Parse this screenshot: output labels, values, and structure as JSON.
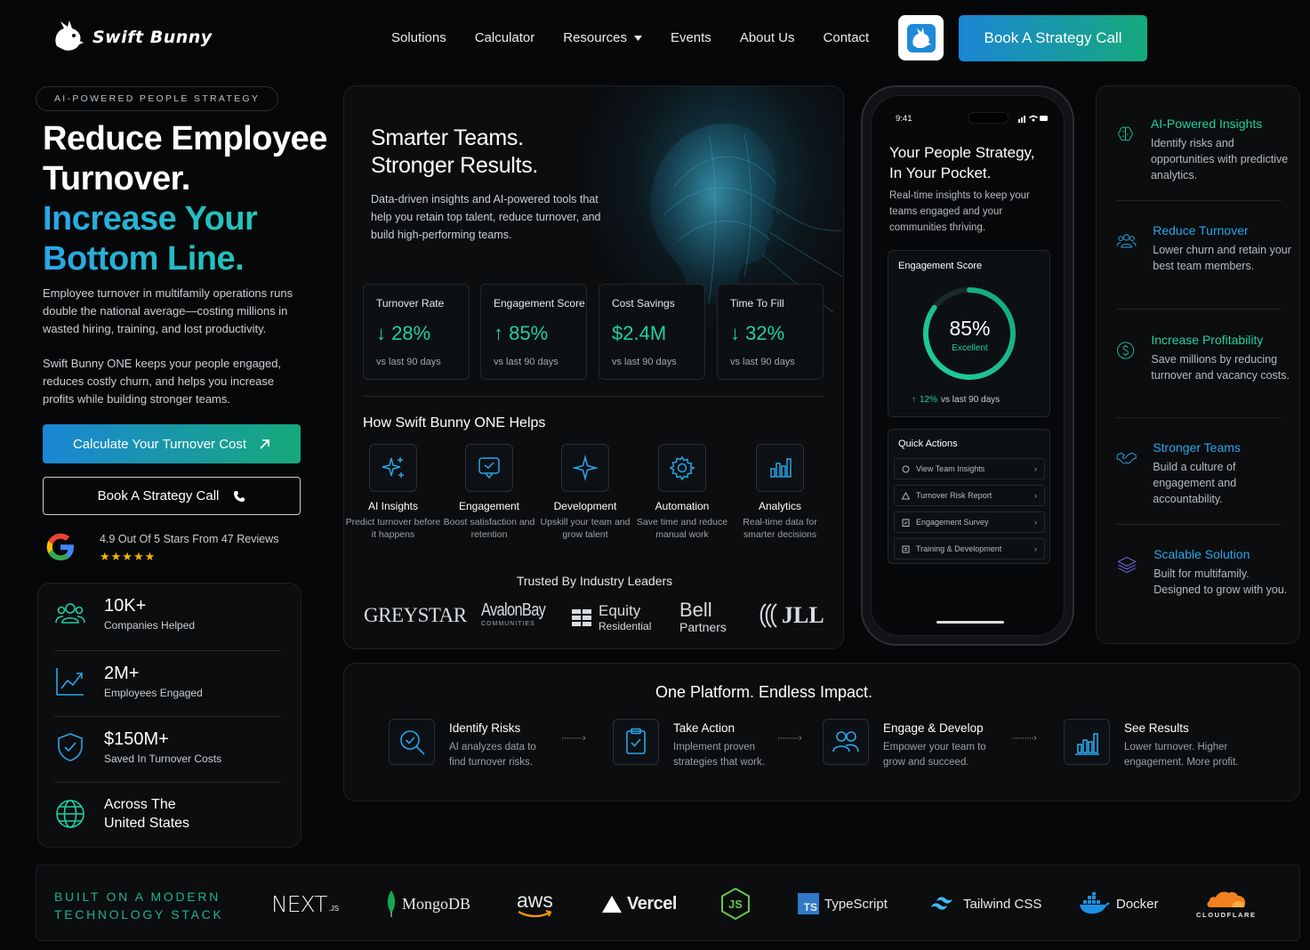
{
  "header": {
    "brand": "Swift Bunny",
    "nav": [
      "Solutions",
      "Calculator",
      "Resources",
      "Events",
      "About Us",
      "Contact"
    ],
    "cta": "Book A Strategy Call"
  },
  "hero": {
    "eyebrow": "AI-POWERED PEOPLE STRATEGY",
    "title_line1": "Reduce Employee",
    "title_line2": "Turnover.",
    "title_line3": "Increase Your",
    "title_line4": "Bottom Line.",
    "para1": "Employee turnover in multifamily operations runs double the national average—costing millions in wasted hiring, training, and lost productivity.",
    "para2": "Swift Bunny ONE keeps your people engaged, reduces costly churn, and helps you increase profits while building stronger teams.",
    "btn_calc": "Calculate Your Turnover Cost",
    "btn_book": "Book A Strategy Call",
    "rating": "4.9 Out Of 5 Stars From 47 Reviews",
    "stars": "★★★★★"
  },
  "stats": [
    {
      "value": "10K+",
      "label": "Companies Helped"
    },
    {
      "value": "2M+",
      "label": "Employees Engaged"
    },
    {
      "value": "$150M+",
      "label": "Saved In Turnover Costs"
    },
    {
      "value": "Across The United States",
      "label": ""
    }
  ],
  "center": {
    "title_line1": "Smarter Teams.",
    "title_line2": "Stronger Results.",
    "subtitle": "Data-driven insights and AI-powered tools that help you retain top talent, reduce turnover, and build high-performing teams.",
    "metrics": [
      {
        "title": "Turnover Rate",
        "value": "↓ 28%",
        "sub": "vs last 90 days"
      },
      {
        "title": "Engagement Score",
        "value": "↑ 85%",
        "sub": "vs last 90 days"
      },
      {
        "title": "Cost Savings",
        "value": "$2.4M",
        "sub": "vs last 90 days"
      },
      {
        "title": "Time To Fill",
        "value": "↓ 32%",
        "sub": "vs last 90 days"
      }
    ],
    "how_title": "How Swift Bunny ONE Helps",
    "features": [
      {
        "title": "AI Insights",
        "sub": "Predict turnover before it happens"
      },
      {
        "title": "Engagement",
        "sub": "Boost satisfaction and retention"
      },
      {
        "title": "Development",
        "sub": "Upskill your team and grow talent"
      },
      {
        "title": "Automation",
        "sub": "Save time and reduce manual work"
      },
      {
        "title": "Analytics",
        "sub": "Real-time data for smarter decisions"
      }
    ],
    "trusted_title": "Trusted By Industry Leaders",
    "brands": {
      "greystar": "GREYSTAR",
      "avalon": "AvalonBay",
      "avalon_sub": "COMMUNITIES",
      "equity": "Equity",
      "equity_sub": "Residential",
      "bell": "Bell",
      "bell_sub": "Partners",
      "jll": "JLL"
    }
  },
  "phone": {
    "time": "9:41",
    "title_line1": "Your People Strategy,",
    "title_line2": "In Your Pocket.",
    "subtitle": "Real-time insights to keep your teams engaged and your communities thriving.",
    "engagement_title": "Engagement Score",
    "score": "85%",
    "score_label": "Excellent",
    "score_fraction": 0.85,
    "delta": "12%",
    "delta_sub": "vs last 90 days",
    "quick_actions_title": "Quick Actions",
    "quick_actions": [
      "View Team Insights",
      "Turnover Risk Report",
      "Engagement Survey",
      "Training & Development"
    ]
  },
  "right_features": [
    {
      "title": "AI-Powered Insights",
      "sub": "Identify risks and opportunities with predictive analytics."
    },
    {
      "title": "Reduce Turnover",
      "sub": "Lower churn and retain your best team members."
    },
    {
      "title": "Increase Profitability",
      "sub": "Save millions by reducing turnover and vacancy costs."
    },
    {
      "title": "Stronger Teams",
      "sub": "Build a culture of engagement and accountability."
    },
    {
      "title": "Scalable Solution",
      "sub": "Built for multifamily. Designed to grow with you."
    }
  ],
  "platform": {
    "title": "One Platform. Endless Impact.",
    "steps": [
      {
        "title": "Identify Risks",
        "sub": "AI analyzes data to find turnover risks."
      },
      {
        "title": "Take Action",
        "sub": "Implement proven strategies that work."
      },
      {
        "title": "Engage & Develop",
        "sub": "Empower your team to grow and succeed."
      },
      {
        "title": "See Results",
        "sub": "Lower turnover. Higher engagement. More profit."
      }
    ]
  },
  "tech": {
    "label_line1": "BUILT ON A MODERN",
    "label_line2": "TECHNOLOGY STACK",
    "logos": {
      "next": "NEXT",
      "next_sub": ".JS",
      "mongo": "MongoDB",
      "aws": "aws",
      "vercel": "Vercel",
      "typescript": "TypeScript",
      "ts_badge": "TS",
      "tailwind": "Tailwind CSS",
      "docker": "Docker",
      "cloudflare": "CLOUDFLARE"
    }
  },
  "colors": {
    "teal": "#1fd1a0",
    "blue": "#2aa6e8",
    "background": "#060708",
    "star": "#f5b400"
  }
}
